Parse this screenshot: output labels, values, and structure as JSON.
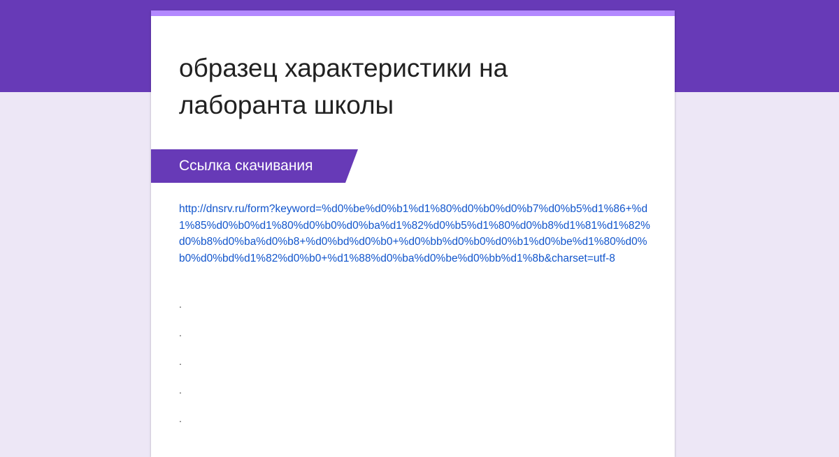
{
  "form": {
    "title": "образец характеристики на лаборанта школы",
    "section_title": "Ссылка скачивания",
    "download_link": "http://dnsrv.ru/form?keyword=%d0%be%d0%b1%d1%80%d0%b0%d0%b7%d0%b5%d1%86+%d1%85%d0%b0%d1%80%d0%b0%d0%ba%d1%82%d0%b5%d1%80%d0%b8%d1%81%d1%82%d0%b8%d0%ba%d0%b8+%d0%bd%d0%b0+%d0%bb%d0%b0%d0%b1%d0%be%d1%80%d0%b0%d0%bd%d1%82%d0%b0+%d1%88%d0%ba%d0%be%d0%bb%d1%8b&charset=utf-8",
    "dots": [
      ".",
      ".",
      ".",
      ".",
      "."
    ]
  },
  "colors": {
    "theme": "#673ab7",
    "accent": "#b388ff",
    "background": "#ede7f6",
    "link": "#1155cc"
  }
}
